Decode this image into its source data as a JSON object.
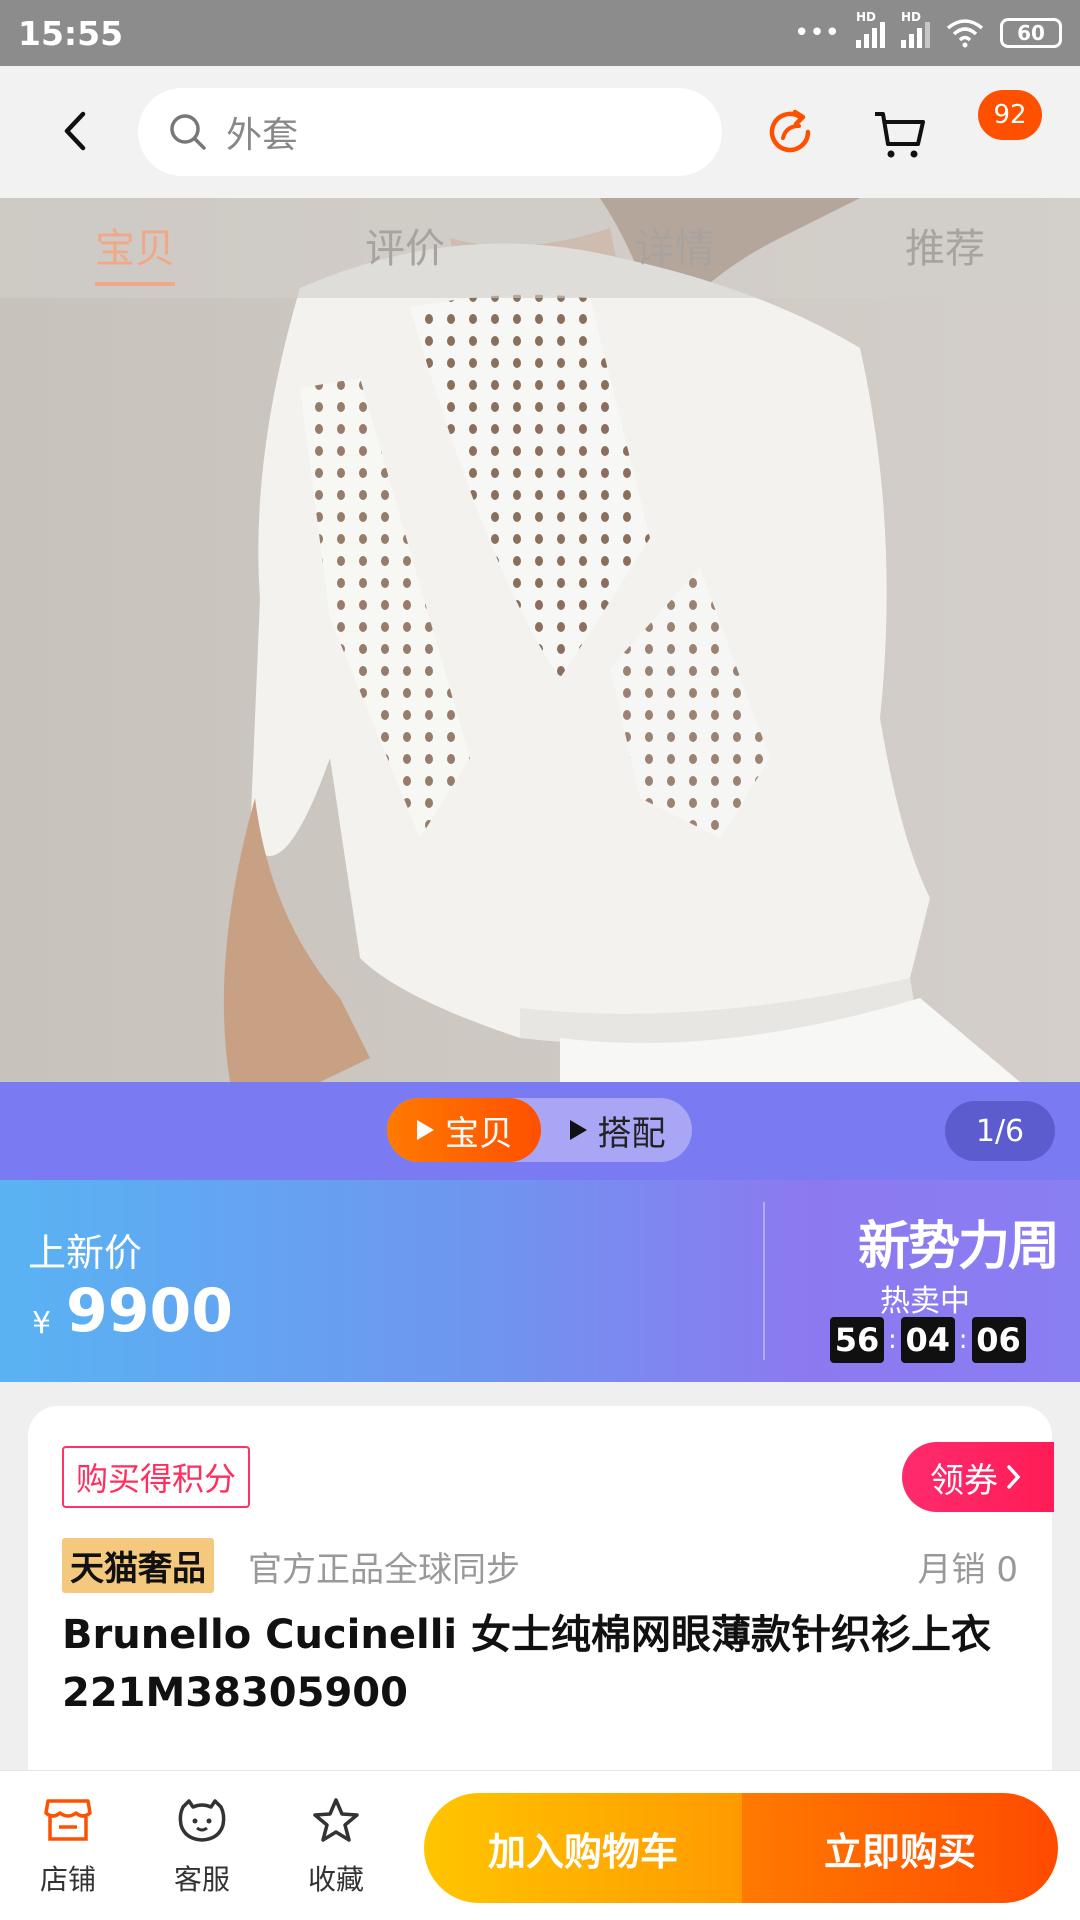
{
  "status_bar": {
    "time": "15:55",
    "dots": "•••",
    "hd1": "HD",
    "hd2": "HD",
    "battery": "60"
  },
  "header": {
    "search_placeholder": "外套",
    "cart_badge": "92"
  },
  "gallery": {
    "tabs": [
      {
        "label": "宝贝",
        "active": true
      },
      {
        "label": "评价",
        "active": false
      },
      {
        "label": "详情",
        "active": false
      },
      {
        "label": "推荐",
        "active": false
      }
    ],
    "media_switch": {
      "item_label": "宝贝",
      "match_label": "搭配"
    },
    "pager": "1/6"
  },
  "price": {
    "label": "上新价",
    "currency": "¥",
    "value": "9900",
    "promo_title": "新势力周",
    "promo_status": "热卖中",
    "countdown": [
      "56",
      "04",
      "06"
    ]
  },
  "product": {
    "points_tag": "购买得积分",
    "coupon_label": "领券",
    "store_tag": "天猫奢品",
    "official_text": "官方正品全球同步",
    "monthly_sales": "月销 0",
    "title": "Brunello Cucinelli 女士纯棉网眼薄款针织衫上衣 221M38305900"
  },
  "bottom_bar": {
    "store": "店铺",
    "service": "客服",
    "favorite": "收藏",
    "add_to_cart": "加入购物车",
    "buy_now": "立即购买"
  },
  "colors": {
    "accent": "#ff5000",
    "price_band_start": "#59b3f3",
    "price_band_end": "#8c79f0",
    "media_bar": "#7a7af2",
    "coupon": "#ff2b6e",
    "add_cart_start": "#ffc500",
    "buy_now_start": "#ff7a00"
  },
  "icons": [
    "back-arrow-icon",
    "search-icon",
    "share-icon",
    "cart-icon",
    "play-icon",
    "store-icon",
    "service-icon",
    "star-icon",
    "chevron-right-icon"
  ]
}
